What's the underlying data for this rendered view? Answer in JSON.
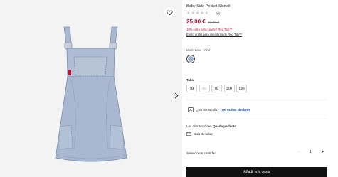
{
  "product": {
    "title": "Baby Side Pocket Skirtall",
    "rating": {
      "stars": 5,
      "filled": 0,
      "count_label": "(0)"
    },
    "price": "25,00 €",
    "old_price": "50,00 €",
    "promo": "10% extra para Levi's® Red Tab™",
    "promo_sub": "Envío gratis para miembros de Red Tab™"
  },
  "color": {
    "label": "Marin Babe - Azul",
    "swatch": "#9fb0c9"
  },
  "size": {
    "label": "Talla",
    "options": [
      {
        "label": "3M",
        "available": true
      },
      {
        "label": "6M",
        "available": false
      },
      {
        "label": "9M",
        "available": true
      },
      {
        "label": "12M",
        "available": true
      },
      {
        "label": "18M",
        "available": true
      }
    ]
  },
  "fit": {
    "question": "¿No ves tu talla?",
    "link": "Ver estilos similares"
  },
  "reviews_summary": {
    "prefix": "Los clientes dicen",
    "value": "Queda perfecto"
  },
  "size_guide": "Guía de tallas",
  "quantity": {
    "label": "Seleccionar cantidad",
    "minus": "-",
    "value": "1",
    "plus": "+"
  },
  "cart_button": "Añadir a la cesta",
  "colors": {
    "sale": "#c41230",
    "button_bg": "#111111",
    "denim": "#a9b8d0"
  },
  "icons": {
    "wishlist": "heart-icon",
    "next": "chevron-right-icon",
    "fit": "hanger-icon",
    "guide": "ruler-icon"
  }
}
